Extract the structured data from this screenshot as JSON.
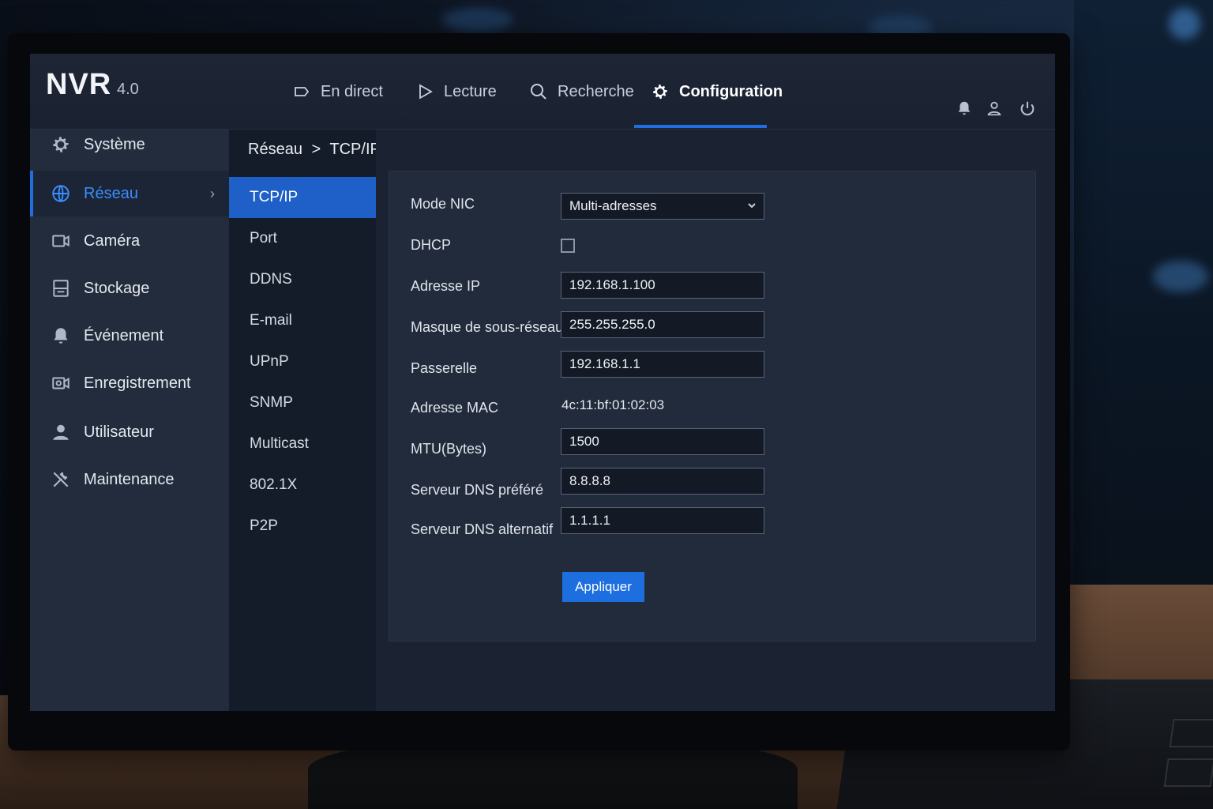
{
  "header": {
    "brand": "NVR",
    "version": "4.0",
    "nav": [
      {
        "label": "En direct",
        "icon": "live-view-icon"
      },
      {
        "label": "Lecture",
        "icon": "play-icon"
      },
      {
        "label": "Recherche",
        "icon": "search-icon"
      },
      {
        "label": "Configuration",
        "icon": "gear-icon",
        "active": true
      }
    ],
    "icons": [
      "bell-icon",
      "user-icon",
      "power-icon"
    ]
  },
  "sidebar": {
    "items": [
      {
        "label": "Système",
        "icon": "gear-icon"
      },
      {
        "label": "Réseau",
        "icon": "globe-icon",
        "active": true
      },
      {
        "label": "Caméra",
        "icon": "camera-icon"
      },
      {
        "label": "Stockage",
        "icon": "storage-icon"
      },
      {
        "label": "Événement",
        "icon": "bell-icon"
      },
      {
        "label": "Enregistrement",
        "icon": "record-icon"
      },
      {
        "label": "Utilisateur",
        "icon": "user-icon"
      },
      {
        "label": "Maintenance",
        "icon": "tools-icon"
      }
    ]
  },
  "breadcrumb": {
    "parent": "Réseau",
    "separator": ">",
    "current": "TCP/IP"
  },
  "submenu": {
    "items": [
      "TCP/IP",
      "Port",
      "DDNS",
      "E-mail",
      "UPnP",
      "SNMP",
      "Multicast",
      "802.1X",
      "P2P"
    ]
  },
  "form": {
    "nic_mode_label": "Mode NIC",
    "nic_mode_value": "Multi-adresses",
    "dhcp_label": "DHCP",
    "dhcp_checked": false,
    "ip_label": "Adresse IP",
    "ip_value": "192.168.1.100",
    "mask_label": "Masque de sous-réseau",
    "mask_value": "255.255.255.0",
    "gateway_label": "Passerelle",
    "gateway_value": "192.168.1.1",
    "mac_label": "Adresse MAC",
    "mac_value": "4c:11:bf:01:02:03",
    "mtu_label": "MTU(Bytes)",
    "mtu_value": "1500",
    "dns1_label": "Serveur DNS préféré",
    "dns1_value": "8.8.8.8",
    "dns2_label": "Serveur DNS alternatif",
    "dns2_value": "1.1.1.1",
    "apply_label": "Appliquer"
  },
  "colors": {
    "accent": "#1f6fe0",
    "active_text": "#3a8dff",
    "panel": "#222b3b",
    "sidebar": "#222c3d"
  }
}
